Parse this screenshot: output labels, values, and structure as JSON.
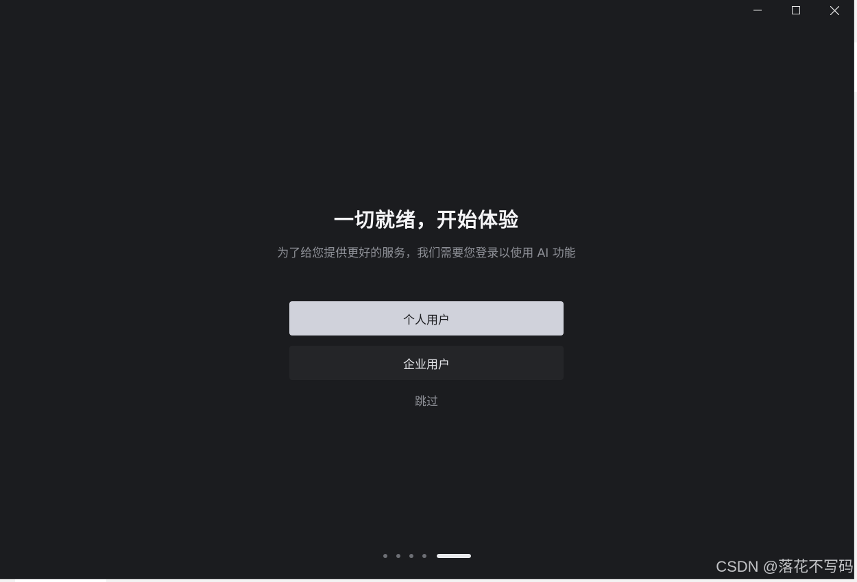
{
  "onboarding": {
    "title": "一切就绪，开始体验",
    "subtitle": "为了给您提供更好的服务，我们需要您登录以使用 AI 功能",
    "personal_button": "个人用户",
    "enterprise_button": "企业用户",
    "skip": "跳过",
    "page_indicator": {
      "total": 5,
      "current": 5
    }
  },
  "window_controls": {
    "minimize_icon": "minimize-icon",
    "maximize_icon": "maximize-icon",
    "close_icon": "close-icon"
  },
  "watermark": "CSDN @落花不写码",
  "colors": {
    "background": "#1b1c1f",
    "primary_button": "#d0d2db",
    "secondary_button": "#242528",
    "muted_text": "#8e9097"
  }
}
